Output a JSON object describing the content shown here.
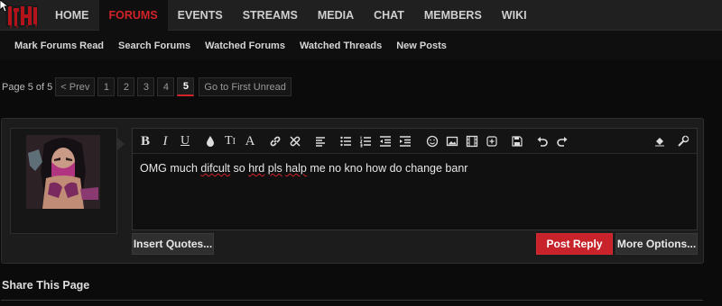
{
  "nav": {
    "items": [
      "HOME",
      "FORUMS",
      "EVENTS",
      "STREAMS",
      "MEDIA",
      "CHAT",
      "MEMBERS",
      "WIKI"
    ],
    "active_index": 1
  },
  "subnav": {
    "items": [
      "Mark Forums Read",
      "Search Forums",
      "Watched Forums",
      "Watched Threads",
      "New Posts"
    ]
  },
  "pagination": {
    "label": "Page 5 of 5",
    "prev": "< Prev",
    "pages": [
      "1",
      "2",
      "3",
      "4",
      "5"
    ],
    "current": "5",
    "first_unread": "Go to First Unread"
  },
  "editor": {
    "text_parts": [
      "OMG much ",
      "difcult",
      " so ",
      "hrd",
      " ",
      "pls",
      " ",
      "halp",
      " me no kno how do change banr"
    ],
    "toolbar_icons": [
      "bold-icon",
      "italic-icon",
      "underline-icon",
      "text-color-icon",
      "font-size-icon",
      "font-family-icon",
      "link-icon",
      "unlink-icon",
      "align-left-icon",
      "unordered-list-icon",
      "ordered-list-icon",
      "outdent-icon",
      "indent-icon",
      "smilie-icon",
      "image-icon",
      "media-icon",
      "insert-icon",
      "save-draft-icon",
      "undo-icon",
      "redo-icon",
      "remove-format-icon",
      "toggle-bbcode-icon"
    ]
  },
  "buttons": {
    "insert_quotes": "Insert Quotes...",
    "post_reply": "Post Reply",
    "more_options": "More Options..."
  },
  "share": {
    "title": "Share This Page"
  },
  "colors": {
    "accent": "#d2232a",
    "nav_bg": "#202020",
    "page_bg": "#0b0b0b"
  }
}
